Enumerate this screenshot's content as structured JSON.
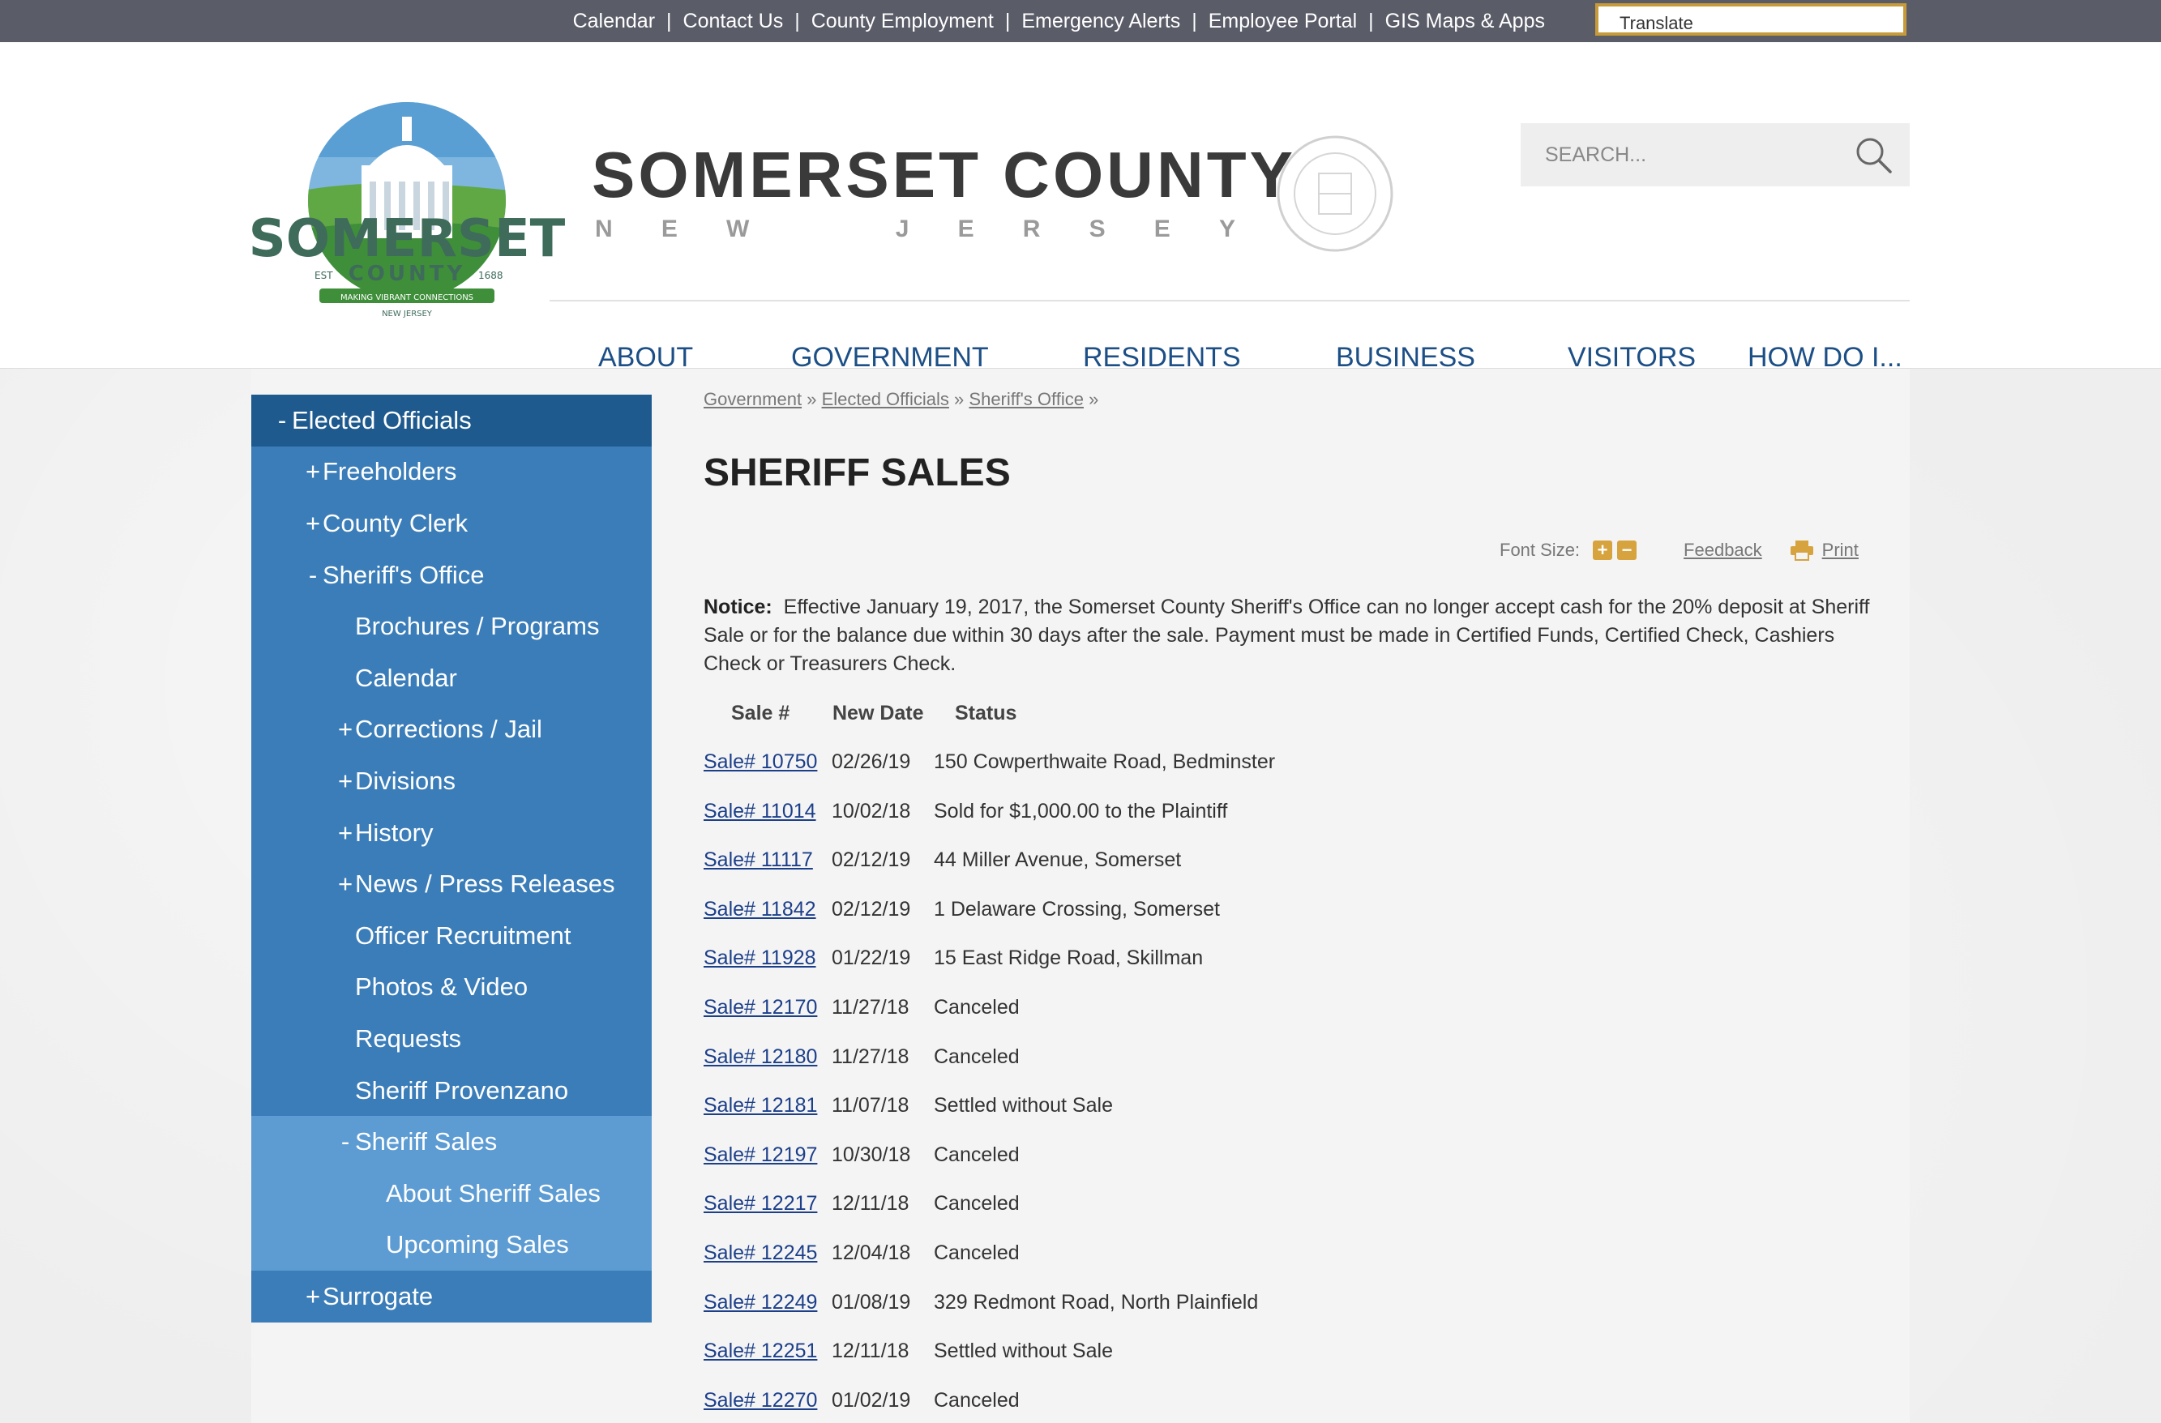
{
  "utility_links": [
    "Calendar",
    "Contact Us",
    "County Employment",
    "Emergency Alerts",
    "Employee Portal",
    "GIS Maps & Apps"
  ],
  "translate_label": "Translate",
  "site": {
    "title": "SOMERSET COUNTY",
    "subtitle_letters": [
      "N",
      "E",
      "W",
      "J",
      "E",
      "R",
      "S",
      "E",
      "Y"
    ],
    "logo_text": "SOMERSET",
    "logo_sub": "COUNTY",
    "logo_est": "EST",
    "logo_year": "1688",
    "logo_tagline": "MAKING VIBRANT CONNECTIONS",
    "logo_state": "NEW JERSEY"
  },
  "search": {
    "placeholder": "SEARCH..."
  },
  "nav": [
    "ABOUT",
    "GOVERNMENT",
    "RESIDENTS",
    "BUSINESS",
    "VISITORS",
    "HOW DO I..."
  ],
  "sidebar": [
    {
      "label": "Elected Officials",
      "mark": "-",
      "level": 0
    },
    {
      "label": "Freeholders",
      "mark": "+",
      "level": 1
    },
    {
      "label": "County Clerk",
      "mark": "+",
      "level": 1
    },
    {
      "label": "Sheriff's Office",
      "mark": "-",
      "level": 1
    },
    {
      "label": "Brochures / Programs",
      "mark": "",
      "level": 2
    },
    {
      "label": "Calendar",
      "mark": "",
      "level": 2
    },
    {
      "label": "Corrections / Jail",
      "mark": "+",
      "level": 2
    },
    {
      "label": "Divisions",
      "mark": "+",
      "level": 2
    },
    {
      "label": "History",
      "mark": "+",
      "level": 2
    },
    {
      "label": "News / Press Releases",
      "mark": "+",
      "level": 2
    },
    {
      "label": "Officer Recruitment",
      "mark": "",
      "level": 2
    },
    {
      "label": "Photos & Video",
      "mark": "",
      "level": 2
    },
    {
      "label": "Requests",
      "mark": "",
      "level": 2
    },
    {
      "label": "Sheriff Provenzano",
      "mark": "",
      "level": 2
    },
    {
      "label": "Sheriff Sales",
      "mark": "-",
      "level": 3
    },
    {
      "label": "About Sheriff Sales",
      "mark": "",
      "level": 4
    },
    {
      "label": "Upcoming Sales",
      "mark": "",
      "level": 4
    },
    {
      "label": "Surrogate",
      "mark": "+",
      "level": 1
    }
  ],
  "breadcrumb": [
    "Government",
    "Elected Officials",
    "Sheriff's Office"
  ],
  "breadcrumb_sep": "»",
  "page_title": "SHERIFF SALES",
  "tools": {
    "font_size_label": "Font Size:",
    "feedback": "Feedback",
    "print": "Print"
  },
  "notice": {
    "label": "Notice:",
    "text": "Effective January 19, 2017, the Somerset County Sheriff's Office can no longer accept cash for the 20% deposit at Sheriff Sale or for the balance due within 30 days after the sale. Payment must be made in Certified Funds, Certified Check, Cashiers Check or Treasurers Check."
  },
  "table": {
    "headers": [
      "Sale #",
      "New Date",
      "Status"
    ],
    "rows": [
      {
        "sale": "Sale# 10750",
        "date": "02/26/19",
        "status": "150 Cowperthwaite Road, Bedminster"
      },
      {
        "sale": "Sale# 11014",
        "date": "10/02/18",
        "status": "Sold for $1,000.00 to the Plaintiff"
      },
      {
        "sale": "Sale# 11117",
        "date": "02/12/19",
        "status": "44 Miller Avenue, Somerset"
      },
      {
        "sale": "Sale# 11842",
        "date": "02/12/19",
        "status": "1 Delaware Crossing, Somerset"
      },
      {
        "sale": "Sale# 11928",
        "date": "01/22/19",
        "status": "15 East Ridge Road, Skillman"
      },
      {
        "sale": "Sale# 12170",
        "date": "11/27/18",
        "status": "Canceled"
      },
      {
        "sale": "Sale# 12180",
        "date": "11/27/18",
        "status": "Canceled"
      },
      {
        "sale": "Sale# 12181",
        "date": "11/07/18",
        "status": "Settled without Sale"
      },
      {
        "sale": "Sale# 12197",
        "date": "10/30/18",
        "status": "Canceled"
      },
      {
        "sale": "Sale# 12217",
        "date": "12/11/18",
        "status": "Canceled"
      },
      {
        "sale": "Sale# 12245",
        "date": "12/04/18",
        "status": "Canceled"
      },
      {
        "sale": "Sale# 12249",
        "date": "01/08/19",
        "status": "329 Redmont Road, North Plainfield"
      },
      {
        "sale": "Sale# 12251",
        "date": "12/11/18",
        "status": "Settled without Sale"
      },
      {
        "sale": "Sale# 12270",
        "date": "01/02/19",
        "status": "Canceled"
      }
    ]
  },
  "colors": {
    "topbar": "#5a5c68",
    "nav_text": "#1c4f86",
    "sidebar_dark": "#1e5a8e",
    "sidebar_mid": "#3b7db8",
    "sidebar_light": "#5d9cd3",
    "link": "#1c3f8a",
    "accent": "#d6a33e"
  }
}
